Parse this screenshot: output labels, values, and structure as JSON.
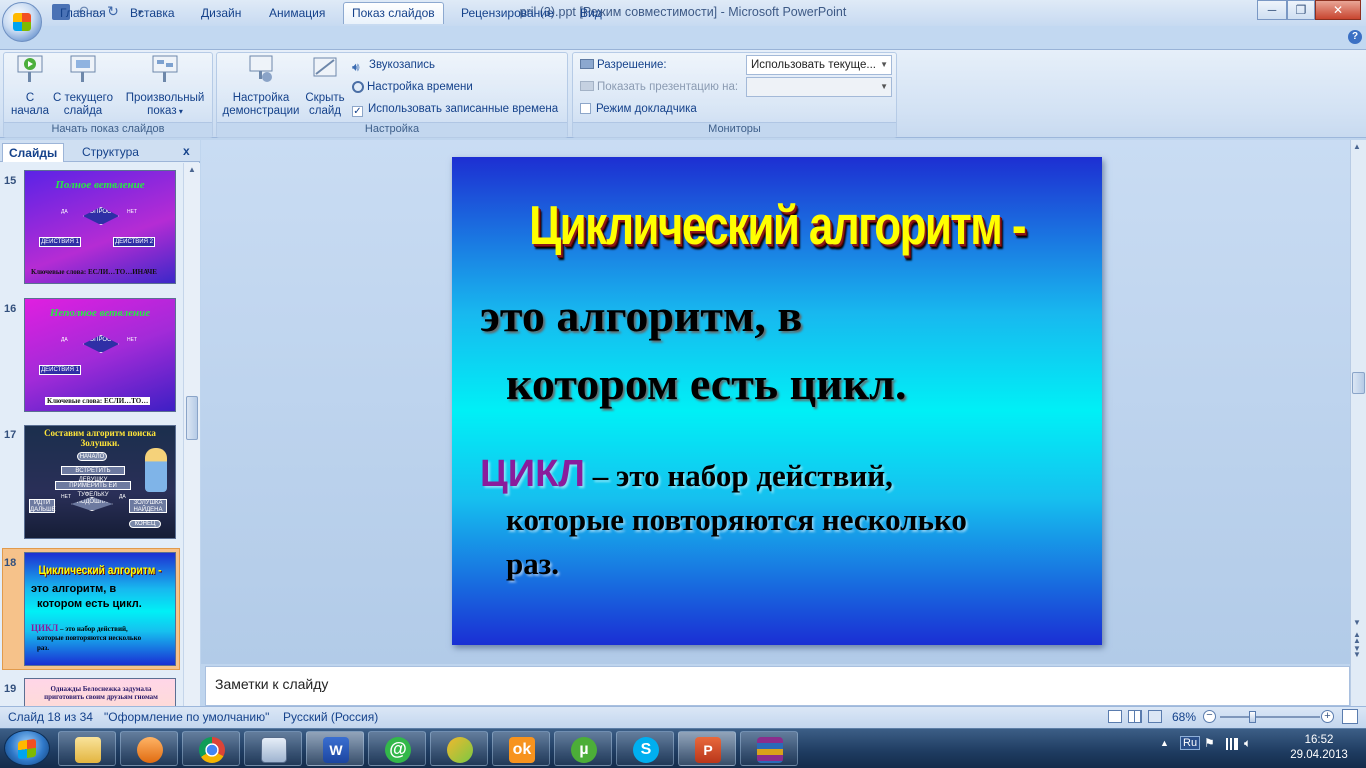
{
  "window": {
    "title": "pril (3).ppt [Режим совместимости] - Microsoft PowerPoint",
    "min": "─",
    "max": "❐",
    "close": "✕"
  },
  "tabs": [
    "Главная",
    "Вставка",
    "Дизайн",
    "Анимация",
    "Показ слайдов",
    "Рецензирование",
    "Вид"
  ],
  "active_tab": "Показ слайдов",
  "ribbon": {
    "start_group": {
      "label": "Начать показ слайдов",
      "from_start": "С\nначала",
      "from_current": "С текущего\nслайда",
      "custom": "Произвольный\nпоказ"
    },
    "setup_group": {
      "label": "Настройка",
      "setup_show": "Настройка\nдемонстрации",
      "hide_slide": "Скрыть\nслайд",
      "record": "Звукозапись",
      "rehearse": "Настройка времени",
      "use_timings": "Использовать записанные времена",
      "use_timings_checked": true
    },
    "monitors_group": {
      "label": "Мониторы",
      "resolution_label": "Разрешение:",
      "resolution_value": "Использовать текуще...",
      "show_on_label": "Показать презентацию на:",
      "show_on_value": "",
      "presenter_view": "Режим докладчика"
    }
  },
  "left_pane": {
    "tab_slides": "Слайды",
    "tab_outline": "Структура",
    "close": "x",
    "thumbs": [
      {
        "num": "15",
        "title": "Полное ветвление",
        "question": "ВОПРОС ?",
        "yes": "ДА",
        "no": "НЕТ",
        "act1": "ДЕЙСТВИЯ 1",
        "act2": "ДЕЙСТВИЯ 2",
        "footer": "Ключевые слова: ЕСЛИ…ТО…ИНАЧЕ"
      },
      {
        "num": "16",
        "title": "Неполное ветвление",
        "question": "ВОПРОС ?",
        "yes": "ДА",
        "no": "НЕТ",
        "act1": "ДЕЙСТВИЯ 1",
        "footer": "Ключевые слова: ЕСЛИ…ТО…"
      },
      {
        "num": "17",
        "title": "Составим алгоритм поиска Золушки.",
        "b1": "НАЧАЛО",
        "b2": "ВСТРЕТИТЬ ДЕВУШКУ",
        "b3": "ПРИМЕРИТЬ ЕЙ ТУФЕЛЬКУ",
        "b4": "ПОДОШЛА",
        "b5": "ИДТИ ДАЛЬШЕ",
        "b6": "ЗОЛУШКА НАЙДЕНА",
        "b7": "КОНЕЦ",
        "yes": "ДА",
        "no": "НЕТ"
      },
      {
        "num": "18",
        "title": "Циклический алгоритм -",
        "l1": "это алгоритм, в",
        "l2": "котором есть цикл.",
        "d1": "ЦИКЛ",
        "d2": " – это набор действий,",
        "d3": "которые повторяются  несколько",
        "d4": "раз."
      },
      {
        "num": "19",
        "title": "Однажды Белоснежка задумала приготовить своим друзьям гномам"
      }
    ]
  },
  "slide": {
    "title": "Циклический алгоритм -",
    "line1": "это алгоритм, в",
    "line2": "котором есть цикл.",
    "def_word": "ЦИКЛ",
    "def_rest": " – это набор действий,",
    "def_line2": "которые повторяются несколько",
    "def_line3": "раз."
  },
  "notes_placeholder": "Заметки к слайду",
  "status": {
    "slide": "Слайд 18 из 34",
    "theme": "\"Оформление по умолчанию\"",
    "lang": "Русский (Россия)",
    "zoom": "68%",
    "zoom_level": 0.68
  },
  "tray": {
    "lang": "Ru",
    "time": "16:52",
    "date": "29.04.2013"
  },
  "colors": {
    "accent": "#15428b",
    "slide_title": "#ffff00",
    "cycle_word": "#8a1c9c"
  }
}
